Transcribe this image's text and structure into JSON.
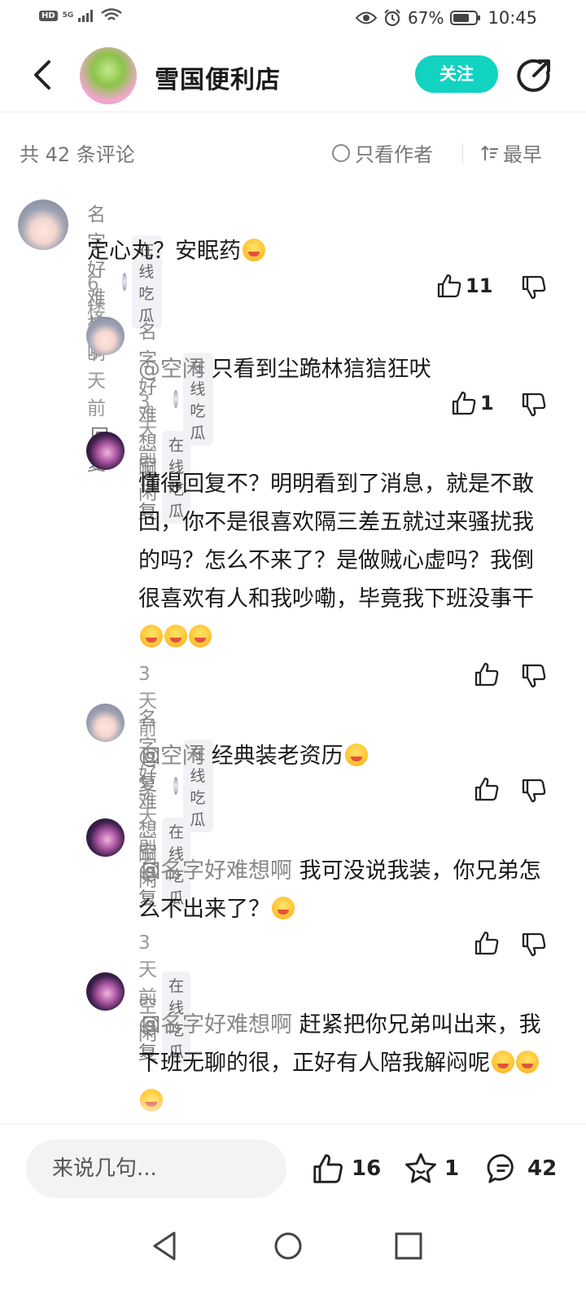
{
  "status_bar": {
    "network_hd": "HD",
    "network_type": "5G",
    "battery": "67%",
    "time": "10:45"
  },
  "header": {
    "title": "雪国便利店",
    "follow_label": "关注"
  },
  "comments_header": {
    "count_label": "共 42 条评论",
    "author_only_label": "只看作者",
    "sort_label": "最早"
  },
  "comments": [
    {
      "name": "名字好难想啊",
      "tag": "在线吃瓜",
      "text": "定心丸？安眠药",
      "floor": "6楼",
      "time": "3 天前",
      "reply_label": "回复",
      "likes": "11"
    },
    {
      "name": "名字好难想啊",
      "tag": "在线吃瓜",
      "mention": "@空闲",
      "text": "只看到尘跪林狺狺狂吠",
      "time": "3 天前",
      "reply_label": "回复",
      "likes": "1"
    },
    {
      "name": "空闲",
      "tag": "在线吃瓜",
      "text": "懂得回复不？明明看到了消息，就是不敢回，你不是很喜欢隔三差五就过来骚扰我的吗？怎么不来了？是做贼心虚吗？我倒很喜欢有人和我吵嘞，毕竟我下班没事干",
      "time": "3 天前",
      "reply_label": "回复",
      "likes": ""
    },
    {
      "name": "名字好难想啊",
      "tag": "在线吃瓜",
      "mention": "@空闲",
      "text": "经典装老资历",
      "time": "3 天前",
      "reply_label": "回复",
      "likes": ""
    },
    {
      "name": "空闲",
      "tag": "在线吃瓜",
      "mention": "@名字好难想啊",
      "text": "我可没说我装，你兄弟怎么不出来了？",
      "time": "3 天前",
      "reply_label": "回复",
      "likes": ""
    },
    {
      "name": "空闲",
      "tag": "在线吃瓜",
      "mention": "@名字好难想啊",
      "text": "赶紧把你兄弟叫出来，我下班无聊的很，正好有人陪我解闷呢"
    }
  ],
  "bottom_bar": {
    "input_placeholder": "来说几句...",
    "like_count": "16",
    "star_count": "1",
    "comment_count": "42"
  },
  "icons": {
    "back": "back-arrow-icon",
    "share": "share-icon",
    "like": "thumbs-up-icon",
    "dislike": "thumbs-down-icon",
    "star": "star-icon",
    "comment": "comment-icon"
  },
  "colors": {
    "accent": "#11d3c0",
    "muted_text": "#888888"
  }
}
